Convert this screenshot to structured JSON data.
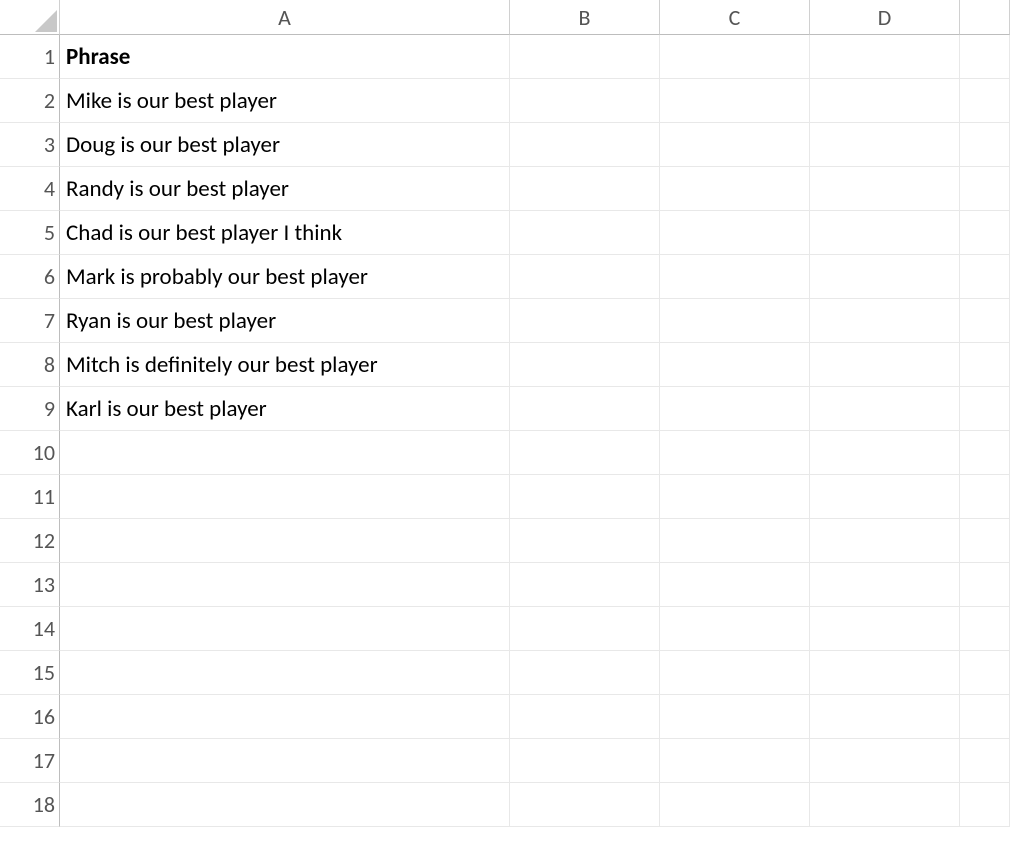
{
  "columns": [
    "A",
    "B",
    "C",
    "D"
  ],
  "rowCount": 18,
  "header": {
    "A": "Phrase"
  },
  "data": {
    "A": [
      "Mike is our best player",
      "Doug is our best player",
      "Randy is our best player",
      "Chad is our best player I think",
      "Mark is probably our best player",
      "Ryan is our best player",
      "Mitch is definitely our best player",
      "Karl is our best player"
    ]
  }
}
